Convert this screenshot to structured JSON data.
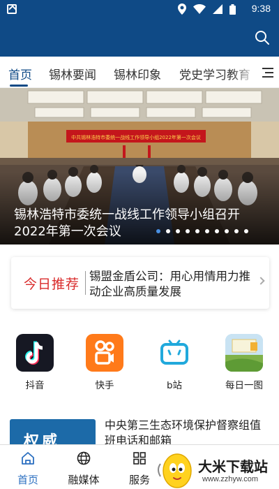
{
  "status_bar": {
    "time": "9:38"
  },
  "tabs": [
    {
      "label": "首页",
      "active": true
    },
    {
      "label": "锡林要闻",
      "active": false
    },
    {
      "label": "锡林印象",
      "active": false
    },
    {
      "label": "党史学习教育",
      "active": false
    }
  ],
  "banner": {
    "title": "锡林浩特市委统一战线工作领导小组召开2022年第一次会议",
    "slide_count": 10,
    "active_slide": 1,
    "backdrop_text": "中共锡林浩特市委统一战线工作领导小组2022年第一次会议"
  },
  "recommend": {
    "label": "今日推荐",
    "text": "锡盟金盾公司：用心用情用力推动企业高质量发展"
  },
  "apps": [
    {
      "label": "抖音",
      "icon": "douyin-icon"
    },
    {
      "label": "快手",
      "icon": "kuaishou-icon"
    },
    {
      "label": "b站",
      "icon": "bilibili-icon"
    },
    {
      "label": "每日一图",
      "icon": "daily-picture-icon"
    }
  ],
  "news": [
    {
      "title": "中央第三生态环境保护督察组值班电话和邮箱",
      "thumb_text": "权威"
    }
  ],
  "bottom_nav": [
    {
      "label": "首页",
      "icon": "home-icon",
      "active": true
    },
    {
      "label": "融媒体",
      "icon": "globe-icon",
      "active": false
    },
    {
      "label": "服务",
      "icon": "grid-icon",
      "active": false
    }
  ],
  "watermark": {
    "text": "大米下载站",
    "url": "www.zzhyw.com"
  },
  "colors": {
    "brand": "#0f4a86",
    "accent_red": "#d92b2b",
    "active_tab": "#0f4a86"
  }
}
